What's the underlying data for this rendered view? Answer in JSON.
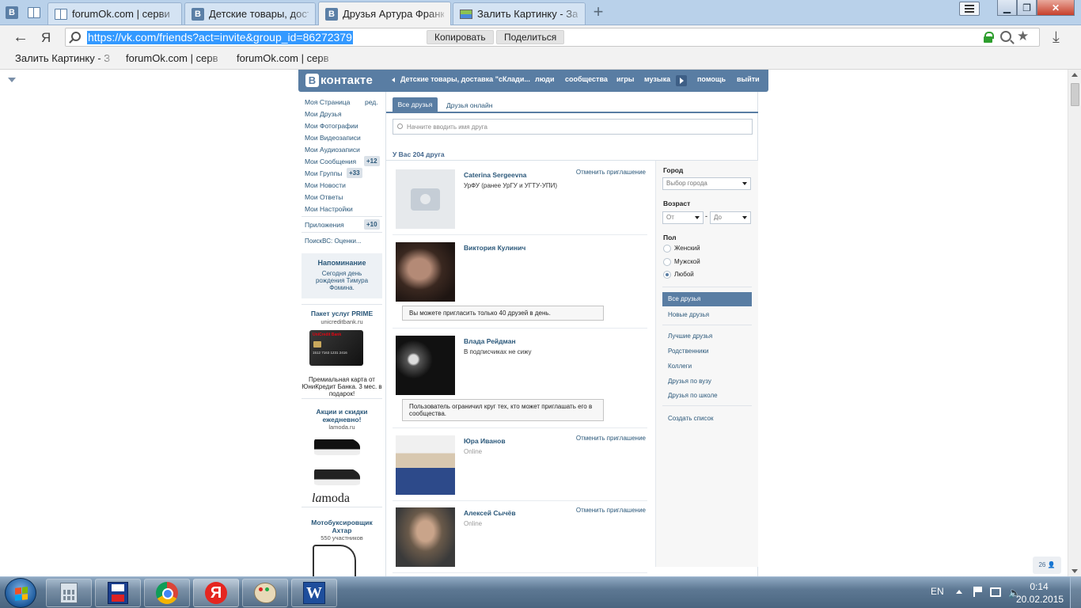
{
  "browser": {
    "tabs": [
      {
        "title": "forumOk.com | серви",
        "icon": "book-icon"
      },
      {
        "title": "Детские товары, дост",
        "icon": "vk-icon"
      },
      {
        "title": "Друзья Артура Франк",
        "icon": "vk-icon",
        "active": true
      },
      {
        "title": "Залить Картинку - За",
        "icon": "picture-icon"
      }
    ],
    "pinned_tab_label": "В",
    "back_glyph": "←",
    "ya_glyph": "Я",
    "url": "https://vk.com/friends?act=invite&group_id=86272379",
    "copy_label": "Копировать",
    "share_label": "Поделиться",
    "star_glyph": "★",
    "download_glyph": "⤓",
    "bookmarks": [
      "Залить Картинку - З",
      "forumOk.com | серв",
      "forumOk.com | серв"
    ]
  },
  "vk": {
    "logo_letter": "В",
    "logo_word": "контакте",
    "header": {
      "group_link": "Детские товары, доставка \"сКлади...",
      "links": [
        "люди",
        "сообщества",
        "игры",
        "музыка"
      ],
      "help": "помощь",
      "logout": "выйти"
    },
    "nav": {
      "items": [
        "Моя Страница",
        "Мои Друзья",
        "Мои Фотографии",
        "Мои Видеозаписи",
        "Мои Аудиозаписи",
        "Мои Сообщения",
        "Мои Группы",
        "Мои Новости",
        "Мои Ответы",
        "Мои Настройки"
      ],
      "edit": "ред.",
      "messages_badge": "+12",
      "groups_badge": "+33",
      "apps": "Приложения",
      "apps_badge": "+10",
      "app_item": "ПоискВС: Оценки..."
    },
    "reminder": {
      "title": "Напоминание",
      "text": "Сегодня день рождения Тимура Фомина."
    },
    "ads": [
      {
        "title": "Пакет услуг PRIME",
        "site": "unicreditbank.ru",
        "card_brand": "UniCredit Bank",
        "card_number": "1512 7163 1231 2416",
        "text": "Премиальная карта от ЮниКредит Банка. 3 мес. в подарок!"
      },
      {
        "title": "Акции и скидки ежедневно!",
        "site": "lamoda.ru",
        "logo_a": "la",
        "logo_b": "moda"
      },
      {
        "title": "Мотобуксировщик Ахтар",
        "site": "550 участников"
      }
    ],
    "tabs": {
      "all": "Все друзья",
      "online": "Друзья онлайн"
    },
    "search_placeholder": "Начните вводить имя друга",
    "count": "У Вас 204 друга",
    "friends": [
      {
        "name": "Caterina Sergeevna",
        "sub": "УрФУ (ранее УрГУ и УГТУ-УПИ)",
        "action": "Отменить приглашение"
      },
      {
        "name": "Виктория Кулинич",
        "sub": "",
        "action": "",
        "note": "Вы можете пригласить только 40 друзей в день."
      },
      {
        "name": "Влада Рейдман",
        "sub": "В подписчиках не сижу",
        "action": "",
        "note": "Пользователь ограничил круг тех, кто может приглашать его в сообщества."
      },
      {
        "name": "Юра Иванов",
        "sub": "Online",
        "action": "Отменить приглашение"
      },
      {
        "name": "Алексей Сычёв",
        "sub": "Online",
        "action": "Отменить приглашение"
      }
    ],
    "filters": {
      "city_label": "Город",
      "city_placeholder": "Выбор города",
      "age_label": "Возраст",
      "age_from": "От",
      "age_to": "До",
      "age_dash": "-",
      "sex_label": "Пол",
      "sex_options": [
        "Женский",
        "Мужской",
        "Любой"
      ],
      "sex_selected": "Любой",
      "lists": [
        "Все друзья",
        "Новые друзья"
      ],
      "lists2": [
        "Лучшие друзья",
        "Родственники",
        "Коллеги",
        "Друзья по вузу",
        "Друзья по школе"
      ],
      "create": "Создать список"
    },
    "counter": "26 👤"
  },
  "taskbar": {
    "lang": "EN",
    "time": "0:14",
    "date": "20.02.2015",
    "word_letter": "W",
    "ya_letter": "Я"
  },
  "colors": {
    "vk_blue": "#597da3",
    "vk_link": "#2b587a",
    "taskbar": "#5d7893"
  }
}
